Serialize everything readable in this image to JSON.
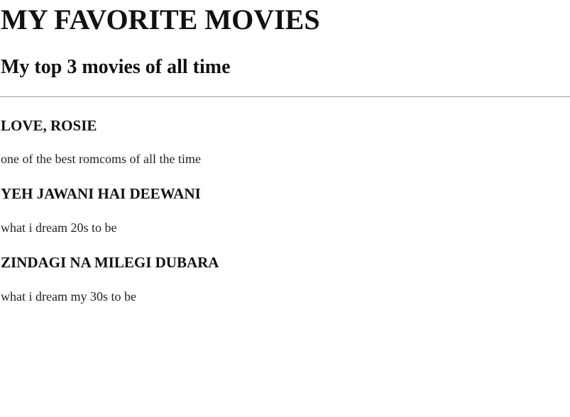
{
  "page": {
    "title": "MY FAVORITE MOVIES",
    "subtitle": "My top 3 movies of all time"
  },
  "movies": [
    {
      "title": "LOVE, ROSIE",
      "description": "one of the best romcoms of all the time"
    },
    {
      "title": "YEH JAWANI HAI DEEWANI",
      "description": "what i dream 20s to be"
    },
    {
      "title": "ZINDAGI NA MILEGI DUBARA",
      "description": "what i dream my 30s to be"
    }
  ]
}
